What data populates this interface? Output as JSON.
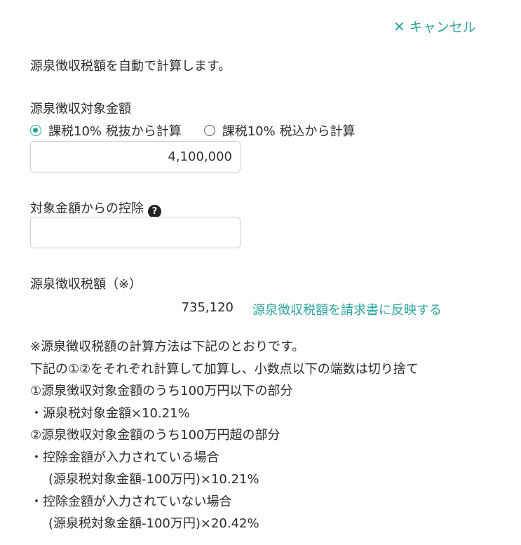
{
  "cancel": {
    "label": "キャンセル",
    "icon": "close-icon"
  },
  "intro": "源泉徴収税額を自動で計算します。",
  "target": {
    "label": "源泉徴収対象金額",
    "radios": [
      {
        "label": "課税10% 税抜から計算",
        "checked": true
      },
      {
        "label": "課税10% 税込から計算",
        "checked": false
      }
    ],
    "value": "4,100,000"
  },
  "deduction": {
    "label": "対象金額からの控除",
    "help_icon": "question-circle-icon",
    "value": ""
  },
  "result": {
    "label": "源泉徴収税額（※）",
    "value": "735,120",
    "link": "源泉徴収税額を請求書に反映する"
  },
  "notes": [
    "※源泉徴収税額の計算方法は下記のとおりです。",
    "下記の①②をそれぞれ計算して加算し、小数点以下の端数は切り捨て",
    "①源泉徴収対象金額のうち100万円以下の部分",
    "・源泉税対象金額×10.21%",
    "②源泉徴収対象金額のうち100万円超の部分",
    "・控除金額が入力されている場合",
    "(源泉税対象金額-100万円)×10.21%",
    "・控除金額が入力されていない場合",
    "(源泉税対象金額-100万円)×20.42%"
  ],
  "colors": {
    "accent": "#2aa39a",
    "text": "#2b2b2b",
    "border": "#cfcfcf"
  }
}
